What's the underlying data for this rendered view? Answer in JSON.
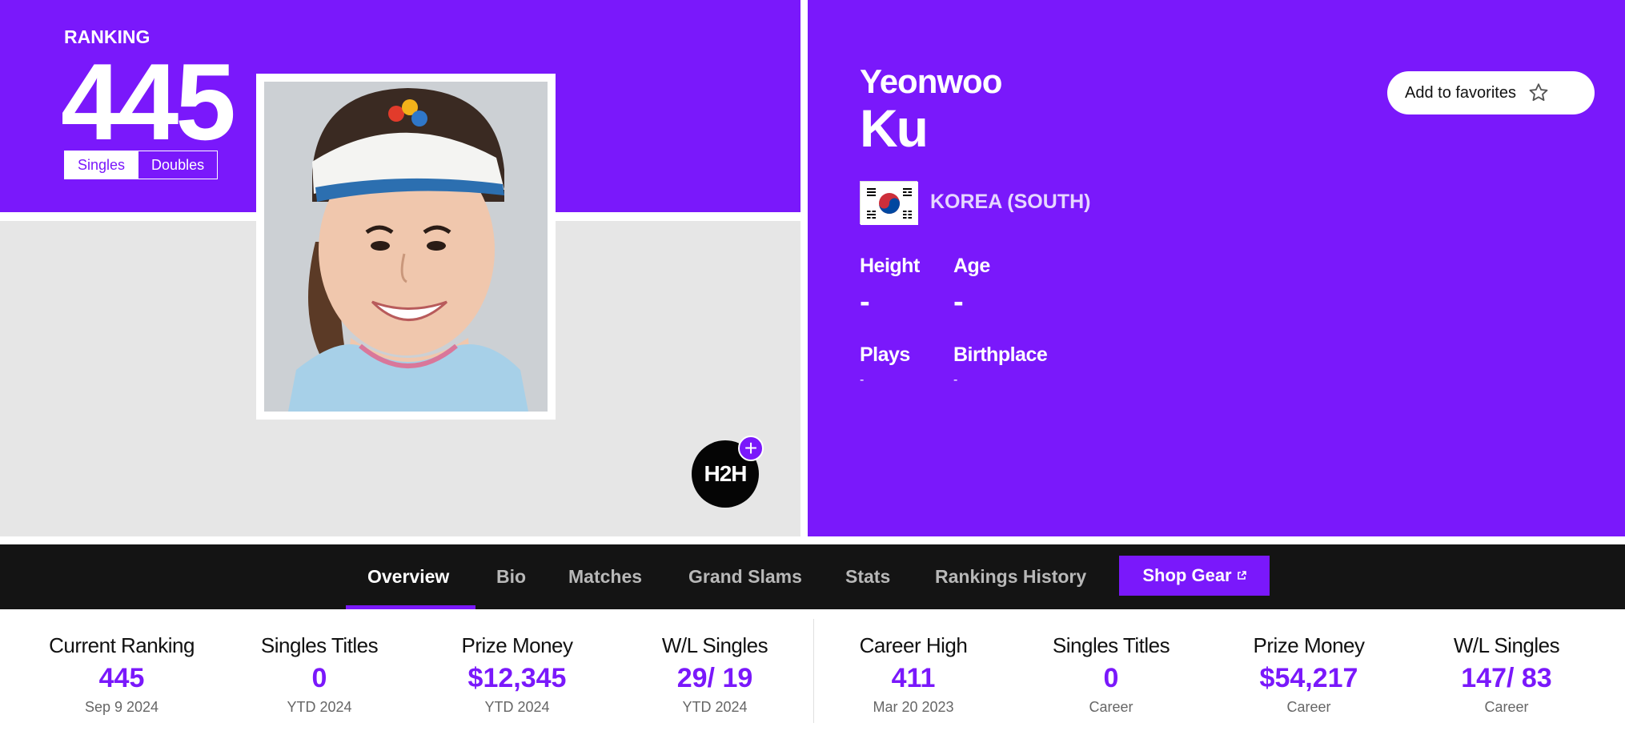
{
  "colors": {
    "brand_purple": "#7a18fb",
    "nav_black": "#141414",
    "gray_panel": "#e6e6e6"
  },
  "ranking": {
    "label": "RANKING",
    "value": "445",
    "toggle": {
      "singles": "Singles",
      "doubles": "Doubles",
      "selected": "Singles"
    }
  },
  "h2h": {
    "label": "H2H",
    "plus_icon": "+"
  },
  "player": {
    "first_name": "Yeonwoo",
    "last_name": "Ku",
    "country": "KOREA (SOUTH)",
    "flag_icon": "south-korea-flag-icon",
    "favorites_label": "Add to favorites",
    "attributes": {
      "height": {
        "label": "Height",
        "value": "-"
      },
      "age": {
        "label": "Age",
        "value": "-"
      },
      "plays": {
        "label": "Plays",
        "value": "-"
      },
      "birthplace": {
        "label": "Birthplace",
        "value": "-"
      }
    }
  },
  "nav": {
    "tabs": [
      "Overview",
      "Bio",
      "Matches",
      "Grand Slams",
      "Stats",
      "Rankings History"
    ],
    "active_tab": "Overview",
    "shop_label": "Shop Gear",
    "shop_icon": "external-link-icon"
  },
  "stats": [
    {
      "label": "Current Ranking",
      "value": "445",
      "sub": "Sep 9 2024"
    },
    {
      "label": "Singles Titles",
      "value": "0",
      "sub": "YTD 2024"
    },
    {
      "label": "Prize Money",
      "value": "$12,345",
      "sub": "YTD 2024"
    },
    {
      "label": "W/L Singles",
      "value": "29/ 19",
      "sub": "YTD 2024"
    },
    {
      "label": "Career High",
      "value": "411",
      "sub": "Mar 20 2023"
    },
    {
      "label": "Singles Titles",
      "value": "0",
      "sub": "Career"
    },
    {
      "label": "Prize Money",
      "value": "$54,217",
      "sub": "Career"
    },
    {
      "label": "W/L Singles",
      "value": "147/ 83",
      "sub": "Career"
    }
  ]
}
